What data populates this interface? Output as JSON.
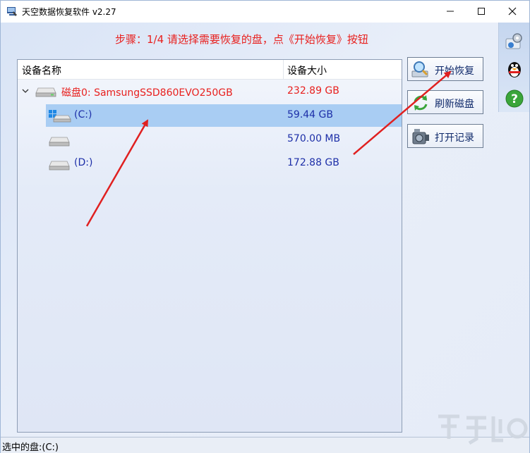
{
  "window": {
    "title": "天空数据恢复软件 v2.27",
    "controls": {
      "minimize": "—",
      "maximize": "☐",
      "close": "✕"
    }
  },
  "step_instruction": "步骤：1/4 请选择需要恢复的盘，点《开始恢复》按钮",
  "device_list": {
    "columns": {
      "name": "设备名称",
      "size": "设备大小"
    },
    "rows": [
      {
        "name": "磁盘0: SamsungSSD860EVO250GB",
        "size": "232.89 GB",
        "level": 0,
        "expanded": true,
        "icon": "hard-disk-icon"
      },
      {
        "name": "(C:)",
        "size": "59.44 GB",
        "level": 1,
        "selected": true,
        "icon": "windows-drive-icon"
      },
      {
        "name": "",
        "size": "570.00 MB",
        "level": 1,
        "icon": "drive-icon"
      },
      {
        "name": "(D:)",
        "size": "172.88 GB",
        "level": 1,
        "icon": "drive-icon"
      }
    ]
  },
  "buttons": {
    "start_recovery": "开始恢复",
    "refresh_disk": "刷新磁盘",
    "open_log": "打开记录"
  },
  "status": {
    "selected_disk": "选中的盘:(C:)"
  },
  "colors": {
    "accent_red": "#e8201e",
    "selection": "#a9cdf3",
    "button_text": "#102a6b",
    "arrow": "#e02020"
  }
}
